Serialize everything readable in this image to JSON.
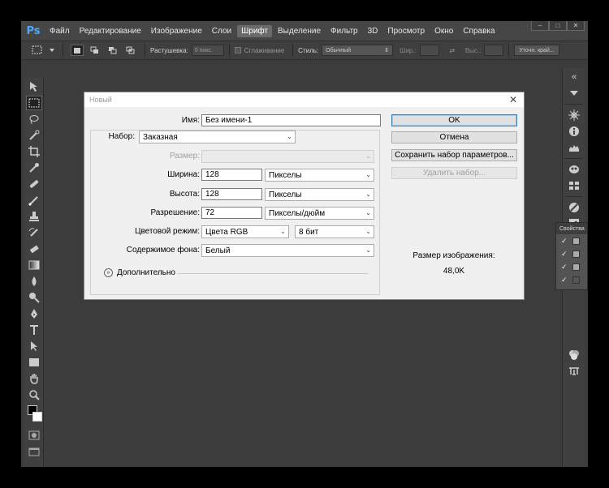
{
  "app": {
    "logo": "Ps",
    "menu": [
      "Файл",
      "Редактирование",
      "Изображение",
      "Слои",
      "Шрифт",
      "Выделение",
      "Фильтр",
      "3D",
      "Просмотр",
      "Окно",
      "Справка"
    ],
    "active_menu_index": 4,
    "window_controls": [
      "–",
      "□",
      "✕"
    ]
  },
  "options_bar": {
    "feather_label": "Растушевка:",
    "feather_value": "0 пикс.",
    "antialias_label": "Сглаживание",
    "style_label": "Стиль:",
    "style_value": "Обычный",
    "width_label": "Шир.:",
    "height_label": "Выс.:",
    "refine_button": "Уточн. край..."
  },
  "properties_panel": {
    "title": "Свойства"
  },
  "dialog": {
    "title": "Новый",
    "name_label": "Имя:",
    "name_value": "Без имени-1",
    "preset_label": "Набор:",
    "preset_value": "Заказная",
    "size_label": "Размер:",
    "size_value": "",
    "width_label": "Ширина:",
    "width_value": "128",
    "width_unit": "Пикселы",
    "height_label": "Высота:",
    "height_value": "128",
    "height_unit": "Пикселы",
    "resolution_label": "Разрешение:",
    "resolution_value": "72",
    "resolution_unit": "Пикселы/дюйм",
    "color_mode_label": "Цветовой режим:",
    "color_mode_value": "Цвета RGB",
    "bit_depth_value": "8 бит",
    "background_label": "Содержимое фона:",
    "background_value": "Белый",
    "advanced_label": "Дополнительно",
    "ok_button": "OK",
    "cancel_button": "Отмена",
    "save_preset_button": "Сохранить набор параметров...",
    "delete_preset_button": "Удалить набор...",
    "image_size_label": "Размер изображения:",
    "image_size_value": "48,0K"
  }
}
